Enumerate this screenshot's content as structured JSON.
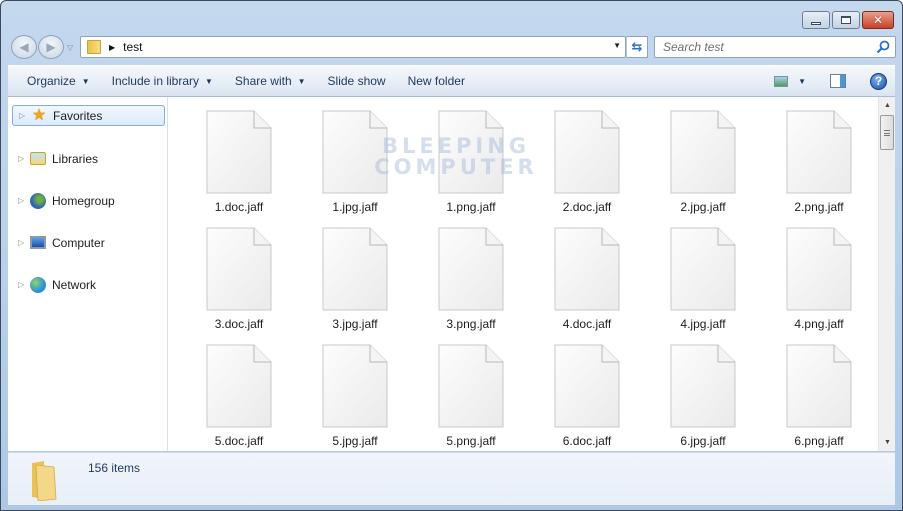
{
  "window": {
    "caption_buttons": {
      "minimize": "minimize",
      "maximize": "maximize",
      "close": "✕"
    }
  },
  "navigation": {
    "back_icon": "back-arrow-icon",
    "forward_icon": "forward-arrow-icon",
    "recent_icon": "chevron-down-icon",
    "address": {
      "folder_icon": "folder-icon",
      "separator": "▶",
      "path": "test",
      "dropdown": "▼"
    },
    "refresh_icon": "refresh-icon",
    "search": {
      "placeholder": "Search test",
      "value": ""
    }
  },
  "toolbar": {
    "items": [
      {
        "label": "Organize",
        "has_arrow": true
      },
      {
        "label": "Include in library",
        "has_arrow": true
      },
      {
        "label": "Share with",
        "has_arrow": true
      },
      {
        "label": "Slide show",
        "has_arrow": false
      },
      {
        "label": "New folder",
        "has_arrow": false
      }
    ],
    "arrow": "▼",
    "help_label": "?"
  },
  "sidebar": {
    "expand_glyph": "▷",
    "items": [
      {
        "label": "Favorites",
        "icon": "star-icon",
        "selected": true
      },
      {
        "label": "Libraries",
        "icon": "libraries-icon",
        "selected": false
      },
      {
        "label": "Homegroup",
        "icon": "homegroup-icon",
        "selected": false
      },
      {
        "label": "Computer",
        "icon": "computer-icon",
        "selected": false
      },
      {
        "label": "Network",
        "icon": "network-icon",
        "selected": false
      }
    ]
  },
  "files": [
    {
      "name": "1.doc.jaff"
    },
    {
      "name": "1.jpg.jaff"
    },
    {
      "name": "1.png.jaff"
    },
    {
      "name": "2.doc.jaff"
    },
    {
      "name": "2.jpg.jaff"
    },
    {
      "name": "2.png.jaff"
    },
    {
      "name": "3.doc.jaff"
    },
    {
      "name": "3.jpg.jaff"
    },
    {
      "name": "3.png.jaff"
    },
    {
      "name": "4.doc.jaff"
    },
    {
      "name": "4.jpg.jaff"
    },
    {
      "name": "4.png.jaff"
    },
    {
      "name": "5.doc.jaff"
    },
    {
      "name": "5.jpg.jaff"
    },
    {
      "name": "5.png.jaff"
    },
    {
      "name": "6.doc.jaff"
    },
    {
      "name": "6.jpg.jaff"
    },
    {
      "name": "6.png.jaff"
    }
  ],
  "watermark": {
    "line1": "BLEEPING",
    "line2": "COMPUTER"
  },
  "scrollbar": {
    "up": "▲",
    "down": "▼"
  },
  "status": {
    "item_count": "156 items"
  }
}
